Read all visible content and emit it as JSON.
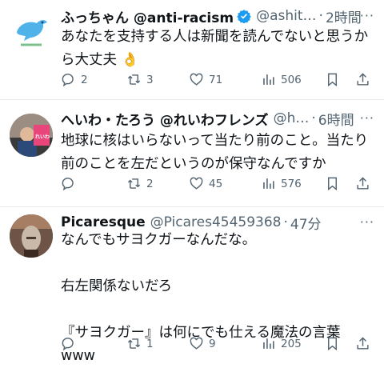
{
  "tweets": [
    {
      "name": "ふっちゃん @anti-racism",
      "handle": "@ashit…",
      "time": "2時間",
      "more": "···",
      "text": "あなたを支持する人は新聞を読んでないと思うか\nら大丈夫 👌",
      "replies": "2",
      "retweets": "3",
      "likes": "71",
      "views": "506",
      "verified": true
    },
    {
      "name": "へいわ・たろう @れいわフレンズ",
      "handle": "@h…",
      "time": "6時間",
      "more": "···",
      "text": "地球に核はいらないって当たり前のこと。当たり\n前のことを左だというのが保守なんですか",
      "replies": "",
      "retweets": "2",
      "likes": "45",
      "views": "576",
      "verified": false,
      "avatar_label": "れいわ"
    },
    {
      "name": "Picaresque",
      "handle": "@Picares45459368",
      "time": "47分",
      "more": "···",
      "text": "なんでもサヨクガーなんだな。\n\n右左関係ないだろ\n\n『サヨクガー』は何にでも仕える魔法の言葉www",
      "replies": "",
      "retweets": "1",
      "likes": "9",
      "views": "205",
      "verified": false
    }
  ],
  "colors": {
    "verified": "#1d9bf0",
    "secondary": "#536471",
    "text": "#0f1419"
  },
  "icons": [
    "reply-icon",
    "retweet-icon",
    "like-icon",
    "views-icon",
    "bookmark-icon",
    "share-icon",
    "verified-badge-icon"
  ]
}
